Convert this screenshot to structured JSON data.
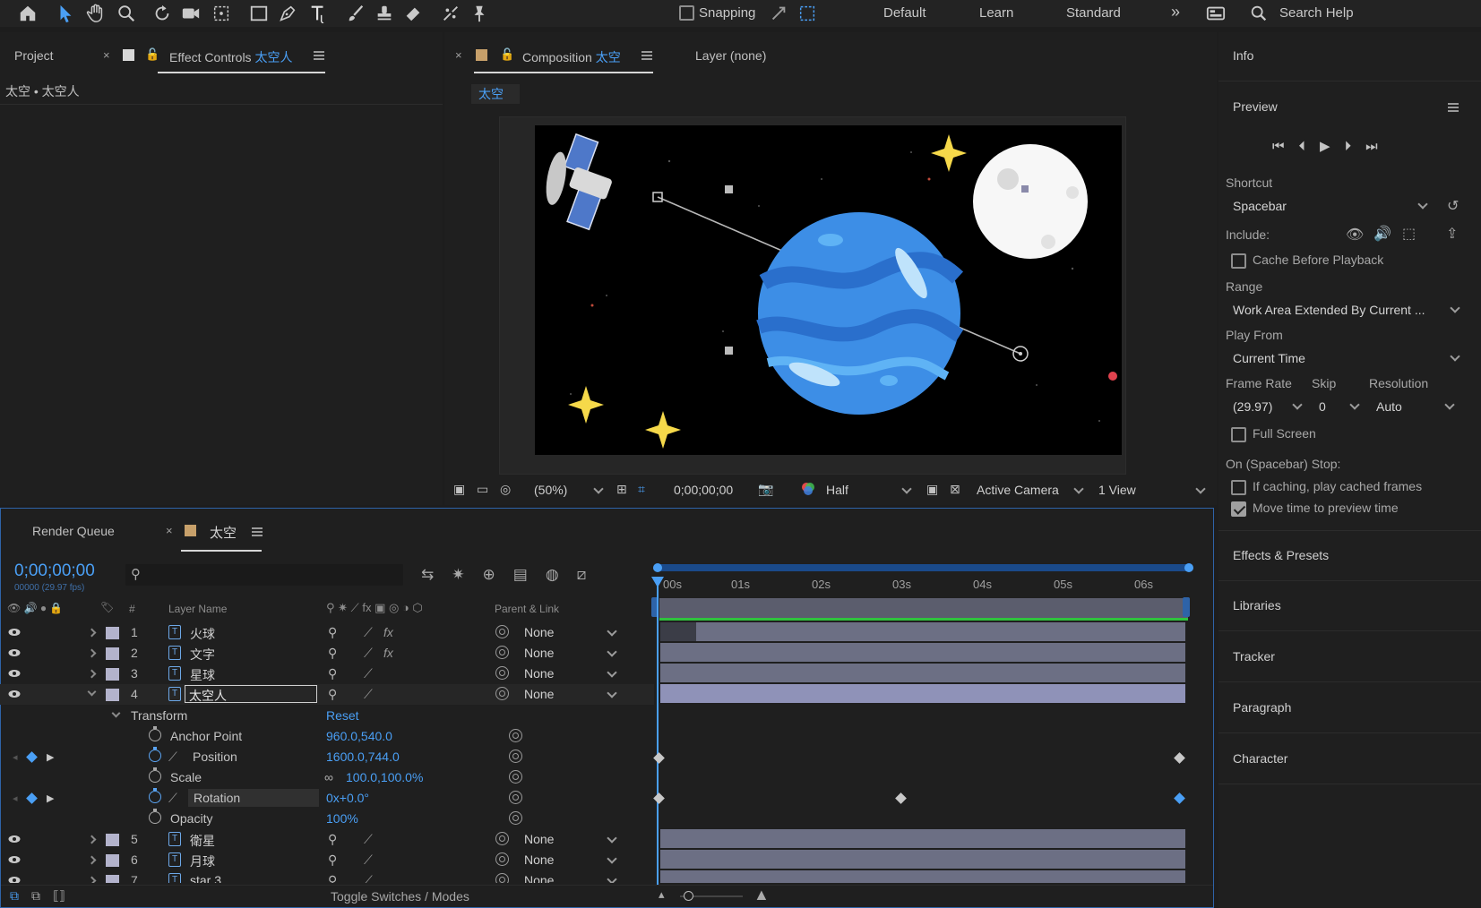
{
  "toolbar": {
    "snapping_label": "Snapping",
    "workspaces": [
      "Default",
      "Learn",
      "Standard"
    ],
    "search_placeholder": "Search Help"
  },
  "left_panel": {
    "tab_project": "Project",
    "tab_effect_controls": "Effect Controls",
    "effect_controls_target": "太空人",
    "breadcrumb": "太空 • 太空人"
  },
  "comp_panel": {
    "tab_composition": "Composition",
    "composition_name": "太空",
    "tab_layer": "Layer (none)",
    "comp_chip": "太空",
    "footer": {
      "zoom": "(50%)",
      "timecode": "0;00;00;00",
      "resolution": "Half",
      "camera": "Active Camera",
      "views": "1 View"
    }
  },
  "right_panel": {
    "info": "Info",
    "preview": "Preview",
    "shortcut_label": "Shortcut",
    "shortcut_value": "Spacebar",
    "include_label": "Include:",
    "cache_before_playback": "Cache Before Playback",
    "range_label": "Range",
    "range_value": "Work Area Extended By Current ...",
    "play_from_label": "Play From",
    "play_from_value": "Current Time",
    "frame_rate_label": "Frame Rate",
    "skip_label": "Skip",
    "resolution_label": "Resolution",
    "frame_rate_value": "(29.97)",
    "skip_value": "0",
    "resolution_value": "Auto",
    "full_screen": "Full Screen",
    "on_stop_label": "On (Spacebar) Stop:",
    "if_caching": "If caching, play cached frames",
    "move_time": "Move time to preview time",
    "collapsed_panels": [
      "Effects & Presets",
      "Libraries",
      "Tracker",
      "Paragraph",
      "Character"
    ],
    "checkboxes": {
      "cache_before_playback": false,
      "full_screen": false,
      "if_caching": false,
      "move_time": true
    }
  },
  "timeline": {
    "tab_render_queue": "Render Queue",
    "tab_comp": "太空",
    "timecode": "0;00;00;00",
    "fps": "00000 (29.97 fps)",
    "col_hash": "#",
    "col_layer_name": "Layer Name",
    "col_parent": "Parent & Link",
    "time_labels": [
      "00s",
      "01s",
      "02s",
      "03s",
      "04s",
      "05s",
      "06s"
    ],
    "layers": [
      {
        "num": "1",
        "name": "火球",
        "parent": "None"
      },
      {
        "num": "2",
        "name": "文字",
        "parent": "None"
      },
      {
        "num": "3",
        "name": "星球",
        "parent": "None"
      },
      {
        "num": "4",
        "name": "太空人",
        "parent": "None"
      },
      {
        "num": "5",
        "name": "衛星",
        "parent": "None"
      },
      {
        "num": "6",
        "name": "月球",
        "parent": "None"
      },
      {
        "num": "7",
        "name": "star 3",
        "parent": "None"
      }
    ],
    "transform_label": "Transform",
    "reset_label": "Reset",
    "props": [
      {
        "name": "Anchor Point",
        "value": "960.0,540.0"
      },
      {
        "name": "Position",
        "value": "1600.0,744.0"
      },
      {
        "name": "Scale",
        "value": "100.0,100.0%"
      },
      {
        "name": "Rotation",
        "value": "0x+0.0°"
      },
      {
        "name": "Opacity",
        "value": "100%"
      }
    ],
    "toggle_label": "Toggle Switches / Modes"
  },
  "colors": {
    "accent": "#4a9ff5",
    "track": "#6c6f84",
    "selected_track": "#8f92b8",
    "work_area": "#2e63a8",
    "star": "#f6d94a",
    "planet": "#3d8ee6",
    "timeline_green": "#2fc23d"
  }
}
